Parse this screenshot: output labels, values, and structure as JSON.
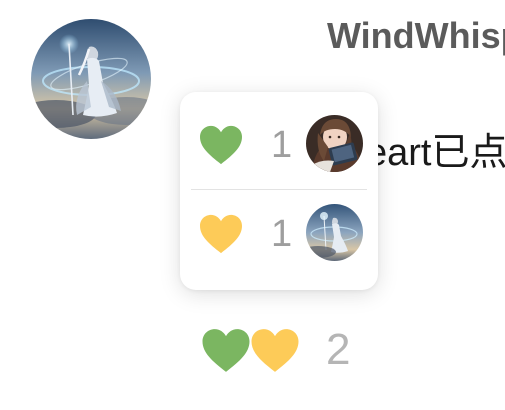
{
  "post": {
    "username": "WindWhisp",
    "message_fragment": "eart已点"
  },
  "reactions_popover": {
    "rows": [
      {
        "icon": "green-heart-icon",
        "color": "#7bb661",
        "count": "1",
        "user_avatar": "anime-girl-reading-avatar"
      },
      {
        "icon": "yellow-heart-icon",
        "color": "#fdcb58",
        "count": "1",
        "user_avatar": "fantasy-sorceress-avatar"
      }
    ]
  },
  "reaction_summary": {
    "icons": [
      "green-heart-icon",
      "yellow-heart-icon"
    ],
    "total": "2"
  },
  "colors": {
    "green_heart": "#7bb661",
    "yellow_heart": "#fdcb58",
    "count_text": "#9e9e9e"
  }
}
